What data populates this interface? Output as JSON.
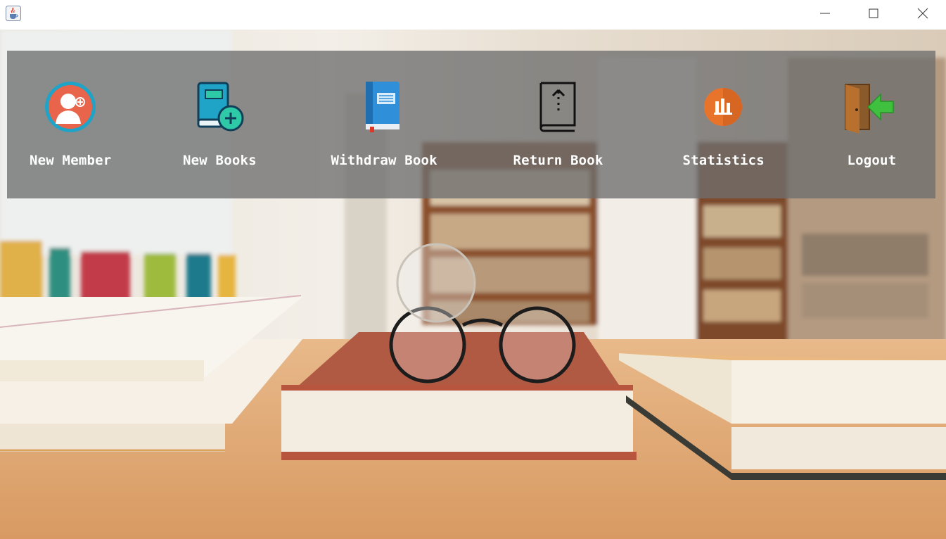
{
  "window": {
    "app_icon": "java-cup-icon",
    "controls": [
      "minimize-icon",
      "maximize-icon",
      "close-icon"
    ]
  },
  "menu": {
    "items": [
      {
        "label": "New Member",
        "icon": "add-user-icon"
      },
      {
        "label": "New Books",
        "icon": "add-book-icon"
      },
      {
        "label": "Withdraw Book",
        "icon": "book-icon"
      },
      {
        "label": "Return Book",
        "icon": "return-book-icon"
      },
      {
        "label": "Statistics",
        "icon": "bar-chart-icon"
      },
      {
        "label": "Logout",
        "icon": "logout-door-icon"
      }
    ]
  },
  "colors": {
    "panel": "#6e6e6e",
    "member_icon": "#e8644a",
    "books_icon": "#1fa4c8",
    "withdraw_icon": "#2f8fd8",
    "statistics_icon": "#e8732a",
    "logout_arrow": "#3fc13f"
  }
}
